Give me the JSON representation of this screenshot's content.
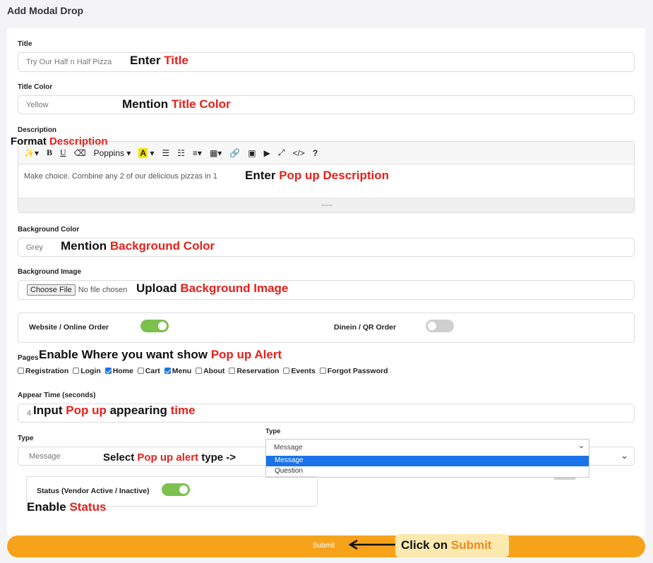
{
  "page": {
    "title": "Add Modal Drop"
  },
  "fields": {
    "title": {
      "label": "Title",
      "placeholder": "Try Our Half n Half Pizza"
    },
    "title_color": {
      "label": "Title Color",
      "placeholder": "Yellow"
    },
    "description": {
      "label": "Description",
      "content": "Make choice. Combine any 2 of our delicious pizzas in 1",
      "toolbar": {
        "font": "Poppins",
        "bold": "B",
        "underline": "U",
        "link_code": "</>",
        "help": "?"
      }
    },
    "background_color": {
      "label": "Background Color",
      "placeholder": "Grey"
    },
    "background_image": {
      "label": "Background Image",
      "button": "Choose File",
      "status": "No file chosen"
    },
    "website_toggle": {
      "label": "Website / Online Order",
      "on": true
    },
    "dinein_toggle": {
      "label": "Dinein / QR Order",
      "on": false
    },
    "pages": {
      "label": "Pages",
      "items": [
        {
          "label": "Registration",
          "checked": false
        },
        {
          "label": "Login",
          "checked": false
        },
        {
          "label": "Home",
          "checked": true
        },
        {
          "label": "Cart",
          "checked": false
        },
        {
          "label": "Menu",
          "checked": true
        },
        {
          "label": "About",
          "checked": false
        },
        {
          "label": "Reservation",
          "checked": false
        },
        {
          "label": "Events",
          "checked": false
        },
        {
          "label": "Forgot Password",
          "checked": false
        }
      ]
    },
    "appear_time": {
      "label": "Appear Time (seconds)",
      "value": "4"
    },
    "type": {
      "label": "Type",
      "value": "Message"
    },
    "type_dropdown": {
      "label": "Type",
      "selected": "Message",
      "options": [
        "Message",
        "Question"
      ],
      "highlighted": "Message"
    },
    "status": {
      "label": "Status (Vendor Active / Inactive)",
      "on": true
    }
  },
  "submit": {
    "label": "Submit"
  },
  "annotations": {
    "title": {
      "a": "Enter ",
      "b": "Title"
    },
    "title_color": {
      "a": "Mention ",
      "b": "Title Color"
    },
    "format": {
      "a": "Format ",
      "b": "Description"
    },
    "description": {
      "a": "Enter ",
      "b": "Pop up Description"
    },
    "bg_color": {
      "a": "Mention ",
      "b": "Background Color"
    },
    "bg_image": {
      "a": "Upload ",
      "b": "Background Image"
    },
    "pages": {
      "a": "Enable Where you want show ",
      "b": "Pop up Alert"
    },
    "appear": {
      "a": "Input ",
      "b": "Pop up",
      "c": " appearing ",
      "d": "time"
    },
    "type": {
      "a": "Select ",
      "b": "Pop up alert",
      "c": " type ->"
    },
    "status": {
      "a": "Enable ",
      "b": "Status"
    },
    "submit": {
      "a": "Click on ",
      "b": "Submit"
    }
  },
  "colors": {
    "accent": "#f7a21b",
    "annotation_red": "#e8201b",
    "toggle_on": "#7cc04e",
    "select_highlight": "#1a73e8"
  }
}
